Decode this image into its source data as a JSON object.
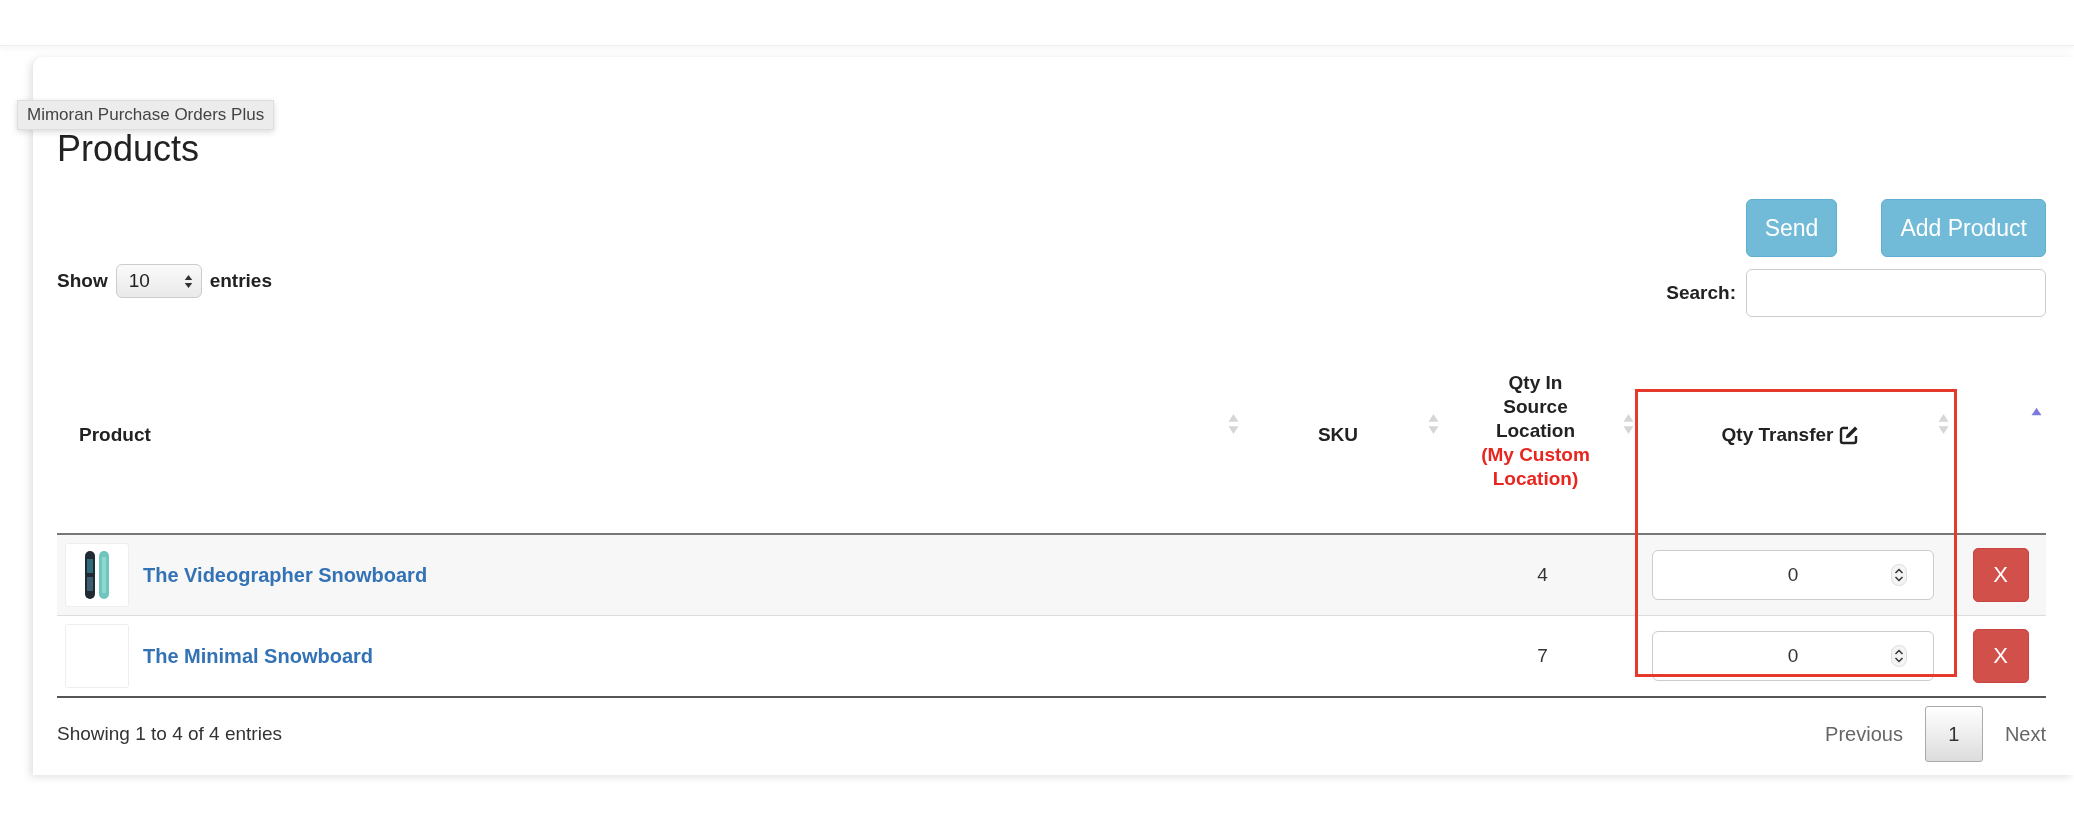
{
  "tooltip": "Mimoran Purchase Orders Plus",
  "title": "Products",
  "buttons": [
    {
      "label": "Send"
    },
    {
      "label": "Add Product"
    }
  ],
  "length": {
    "before": "Show",
    "value": "10",
    "after": "entries"
  },
  "search": {
    "label": "Search:"
  },
  "columns": [
    {
      "label": "Product",
      "kind": "text",
      "sorted": false
    },
    {
      "label": "SKU",
      "kind": "text",
      "sorted": false
    },
    {
      "label": "Qty In Source Location",
      "note": "(My Custom Location)",
      "kind": "text",
      "sorted": false
    },
    {
      "label": "Qty Transfer",
      "kind": "editable",
      "sorted": false,
      "highlighted": true
    },
    {
      "kind": "action",
      "sorted": true
    }
  ],
  "rows": [
    {
      "product": "The Videographer Snowboard",
      "has_image": true,
      "qty_source": "4",
      "transfer": "0",
      "remove": "X"
    },
    {
      "product": "The Minimal Snowboard",
      "has_image": false,
      "qty_source": "7",
      "transfer": "0",
      "remove": "X"
    }
  ],
  "pagination": {
    "summary": "Showing 1 to 4 of 4 entries",
    "previous": "Previous",
    "pages": [
      {
        "label": "1",
        "selected": true
      }
    ],
    "next": "Next"
  }
}
